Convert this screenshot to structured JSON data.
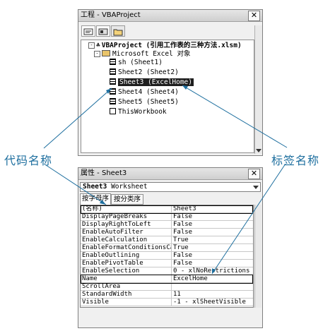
{
  "project_pane": {
    "title": "工程 - VBAProject",
    "close_glyph": "✕",
    "toolbar": [
      {
        "icon": "view-code-icon"
      },
      {
        "icon": "view-object-icon"
      },
      {
        "icon": "toggle-folders-icon"
      }
    ],
    "tree": {
      "root": "VBAProject (引用工作表的三种方法.xlsm)",
      "folder": "Microsoft Excel 对象",
      "items": [
        {
          "label": "sh (Sheet1)",
          "selected": false
        },
        {
          "label": "Sheet2 (Sheet2)",
          "selected": false
        },
        {
          "code_name": "Sheet3",
          "tab_name": "ExcelHome",
          "selected": true
        },
        {
          "label": "Sheet4 (Sheet4)",
          "selected": false
        },
        {
          "label": "Sheet5 (Sheet5)",
          "selected": false
        },
        {
          "label": "ThisWorkbook",
          "selected": false
        }
      ]
    }
  },
  "annotations": {
    "code_name_label": "代码名称",
    "tab_name_label": "标签名称",
    "color": "#1e6f9f"
  },
  "properties_pane": {
    "title": "属性 - Sheet3",
    "close_glyph": "✕",
    "object_selector": {
      "name": "Sheet3",
      "type": "Worksheet"
    },
    "tabs": [
      "按字母序",
      "按分类序"
    ],
    "rows": [
      {
        "name": "(名称)",
        "value": "Sheet3"
      },
      {
        "name": "DisplayPageBreaks",
        "value": "False"
      },
      {
        "name": "DisplayRightToLeft",
        "value": "False"
      },
      {
        "name": "EnableAutoFilter",
        "value": "False"
      },
      {
        "name": "EnableCalculation",
        "value": "True"
      },
      {
        "name": "EnableFormatConditionsCalcu",
        "value": "True"
      },
      {
        "name": "EnableOutlining",
        "value": "False"
      },
      {
        "name": "EnablePivotTable",
        "value": "False"
      },
      {
        "name": "EnableSelection",
        "value": "0 - xlNoRestrictions"
      },
      {
        "name": "Name",
        "value": "ExcelHome"
      },
      {
        "name": "ScrollArea",
        "value": ""
      },
      {
        "name": "StandardWidth",
        "value": "11"
      },
      {
        "name": "Visible",
        "value": "-1 - xlSheetVisible"
      }
    ]
  }
}
